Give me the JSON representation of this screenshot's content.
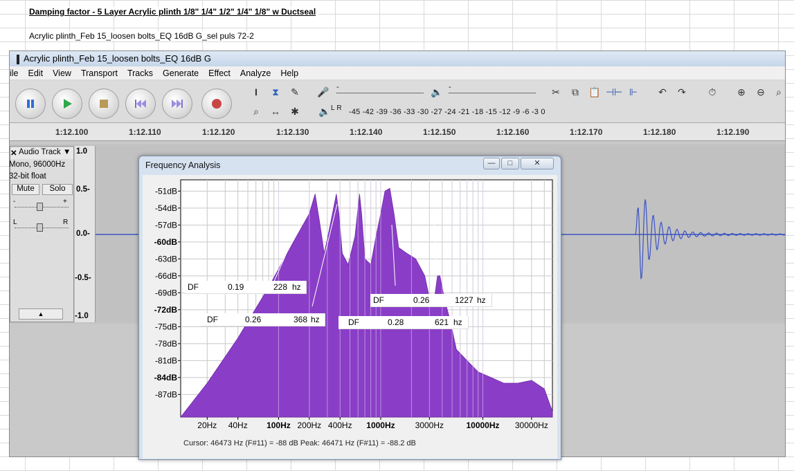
{
  "sheet": {
    "title": "Damping factor  - 5 Layer Acrylic plinth   1/8\" 1/4\" 1/2\" 1/4\" 1/8\"  w Ductseal",
    "subtitle": "Acrylic plinth_Feb 15_loosen bolts_EQ 16dB G_sel puls 72-2"
  },
  "window": {
    "title": "Acrylic plinth_Feb 15_loosen bolts_EQ 16dB G"
  },
  "menu": [
    "ile",
    "Edit",
    "View",
    "Transport",
    "Tracks",
    "Generate",
    "Effect",
    "Analyze",
    "Help"
  ],
  "meter": {
    "scale": "-45 -42 -39 -36 -33 -30 -27 -24 -21 -18 -15 -12 -9 -6 -3 0",
    "channels": "L R",
    "minus": "-",
    "plus": "+"
  },
  "timeline": [
    "1:12.100",
    "1:12.110",
    "1:12.120",
    "1:12.130",
    "1:12.140",
    "1:12.150",
    "1:12.160",
    "1:12.170",
    "1:12.180",
    "1:12.190"
  ],
  "track": {
    "name": "Audio Track",
    "format": "Mono, 96000Hz",
    "bits": "32-bit float",
    "mute": "Mute",
    "solo": "Solo",
    "gain_minus": "-",
    "gain_plus": "+",
    "pan_left": "L",
    "pan_right": "R",
    "collapse": "▲",
    "scale": [
      "1.0",
      "0.5-",
      "0.0-",
      "-0.5-",
      "-1.0"
    ]
  },
  "dialog": {
    "title": "Frequency Analysis",
    "minimize": "—",
    "maximize": "□",
    "close": "✕",
    "status": "Cursor: 46473 Hz (F#11) = -88 dB    Peak: 46471 Hz (F#11) = -88.2 dB"
  },
  "chart_data": {
    "type": "area",
    "title": "",
    "xlabel": "",
    "ylabel": "",
    "x_scale": "log",
    "grid": true,
    "y_tick_labels": [
      "-51dB",
      "-54dB",
      "-57dB",
      "-60dB",
      "-63dB",
      "-66dB",
      "-69dB",
      "-72dB",
      "-75dB",
      "-78dB",
      "-81dB",
      "-84dB",
      "-87dB"
    ],
    "x_tick_labels": [
      "20Hz",
      "40Hz",
      "100Hz",
      "200Hz",
      "400Hz",
      "1000Hz",
      "3000Hz",
      "10000Hz",
      "30000Hz"
    ],
    "ylim": [
      -91,
      -49
    ],
    "xlim": [
      11,
      48000
    ],
    "x": [
      11,
      20,
      40,
      80,
      150,
      200,
      228,
      250,
      280,
      320,
      368,
      390,
      420,
      480,
      560,
      621,
      650,
      700,
      800,
      900,
      1000,
      1100,
      1227,
      1350,
      1500,
      1800,
      2200,
      2700,
      3000,
      3300,
      3600,
      3800,
      4200,
      4800,
      5500,
      7000,
      9000,
      12000,
      16000,
      22000,
      30000,
      40000,
      48000
    ],
    "y": [
      -91,
      -85,
      -77,
      -68,
      -59,
      -55,
      -51.5,
      -56,
      -62,
      -57,
      -51.5,
      -55,
      -62,
      -64,
      -59,
      -51.5,
      -55,
      -63,
      -64,
      -59,
      -55,
      -51,
      -50.5,
      -55,
      -61,
      -62,
      -63,
      -66,
      -70,
      -71,
      -66,
      -66,
      -70,
      -74,
      -79,
      -81,
      -83,
      -84,
      -85,
      -85,
      -84.5,
      -86,
      -90
    ]
  },
  "df_labels": [
    {
      "label": "DF",
      "value": "0.19",
      "freq": "228",
      "unit": "hz"
    },
    {
      "label": "DF",
      "value": "0.26",
      "freq": "368",
      "unit": "hz"
    },
    {
      "label": "DF",
      "value": "0.28",
      "freq": "621",
      "unit": "hz"
    },
    {
      "label": "DF",
      "value": "0.26",
      "freq": "1227",
      "unit": "hz"
    }
  ],
  "colors": {
    "spectrum": "#8a3ec7",
    "waveform": "#3a52c4"
  }
}
